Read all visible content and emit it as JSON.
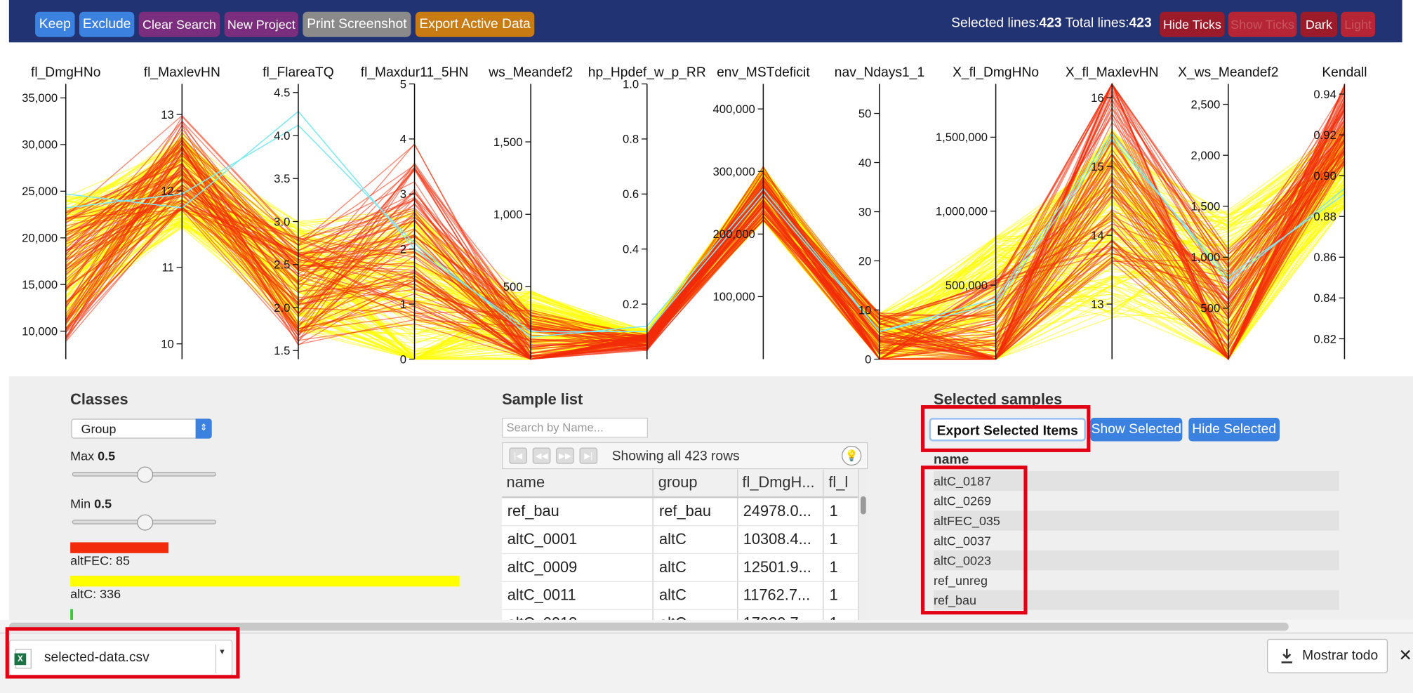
{
  "toolbar": {
    "keep": "Keep",
    "exclude": "Exclude",
    "clear_search": "Clear Search",
    "new_project": "New Project",
    "print_screenshot": "Print Screenshot",
    "export_active_data": "Export Active Data",
    "selected_lines_label": "Selected lines:",
    "selected_lines": "423",
    "total_lines_label": "Total lines:",
    "total_lines": "423",
    "hide_ticks": "Hide Ticks",
    "show_ticks": "Show Ticks",
    "dark": "Dark",
    "light": "Light",
    "colors": {
      "bar_bg": "#213372",
      "keep": "#3b82e0",
      "exclude": "#3b82e0",
      "clear": "#7b2d7e",
      "new": "#7b2d7e",
      "print": "#8a8a8a",
      "export": "#c77b12",
      "hide": "#9b1b2a",
      "disabled": "#b52535"
    }
  },
  "chart_data": {
    "type": "parallel_coordinates",
    "axes": [
      {
        "name": "fl_DmgHNo",
        "ticks": [
          "10,000",
          "15,000",
          "20,000",
          "25,000",
          "30,000",
          "35,000"
        ],
        "range": [
          7000,
          36500
        ]
      },
      {
        "name": "fl_MaxlevHN",
        "ticks": [
          "10",
          "11",
          "12",
          "13"
        ],
        "range": [
          9.8,
          13.4
        ]
      },
      {
        "name": "fl_FlareaTQ",
        "ticks": [
          "1.5",
          "2.0",
          "2.5",
          "3.0",
          "3.5",
          "4.0",
          "4.5"
        ],
        "range": [
          1.4,
          4.6
        ]
      },
      {
        "name": "fl_Maxdur11_5HN",
        "ticks": [
          "0",
          "1",
          "2",
          "3",
          "4",
          "5"
        ],
        "range": [
          0,
          5
        ]
      },
      {
        "name": "ws_Meandef2",
        "ticks": [
          "500",
          "1,000",
          "1,500"
        ],
        "range": [
          0,
          1900
        ]
      },
      {
        "name": "hp_Hpdef_w_p_RR",
        "ticks": [
          "0.2",
          "0.4",
          "0.6",
          "0.8",
          "1.0"
        ],
        "range": [
          0,
          1
        ]
      },
      {
        "name": "env_MSTdeficit",
        "ticks": [
          "100,000",
          "200,000",
          "300,000",
          "400,000"
        ],
        "range": [
          0,
          440000
        ]
      },
      {
        "name": "nav_Ndays1_1",
        "ticks": [
          "0",
          "10",
          "20",
          "30",
          "40",
          "50"
        ],
        "range": [
          0,
          56
        ]
      },
      {
        "name": "X_fl_DmgHNo",
        "ticks": [
          "500,000",
          "1,000,000",
          "1,500,000"
        ],
        "range": [
          0,
          1860000
        ]
      },
      {
        "name": "X_fl_MaxlevHN",
        "ticks": [
          "13",
          "14",
          "15",
          "16"
        ],
        "range": [
          12.2,
          16.2
        ]
      },
      {
        "name": "X_ws_Meandef2",
        "ticks": [
          "500",
          "1,000",
          "1,500",
          "2,000",
          "2,500"
        ],
        "range": [
          0,
          2700
        ]
      },
      {
        "name": "Kendall",
        "ticks": [
          "0.82",
          "0.84",
          "0.86",
          "0.88",
          "0.90",
          "0.92",
          "0.94"
        ],
        "range": [
          0.81,
          0.945
        ]
      }
    ],
    "series": [
      {
        "name": "altFEC",
        "count": 85,
        "color": "#f22b0a"
      },
      {
        "name": "altC",
        "count": 336,
        "color": "#ffff00"
      },
      {
        "name": "ref",
        "count": 2,
        "color": "#7fe8f0"
      }
    ],
    "grid": false
  },
  "classes": {
    "title": "Classes",
    "group_select": "Group",
    "max_label": "Max",
    "max_value": "0.5",
    "min_label": "Min",
    "min_value": "0.5",
    "legend": [
      {
        "label": "altFEC: 85",
        "count": 85,
        "color": "#f22b0a"
      },
      {
        "label": "altC: 336",
        "count": 336,
        "color": "#ffff00"
      },
      {
        "label": "",
        "count": 2,
        "color": "#33cc33"
      }
    ]
  },
  "sample_list": {
    "title": "Sample list",
    "search_placeholder": "Search by Name...",
    "showing": "Showing all 423 rows",
    "columns": [
      "name",
      "group",
      "fl_DmgH...",
      "fl_l"
    ],
    "rows": [
      [
        "ref_bau",
        "ref_bau",
        "24978.0...",
        "1"
      ],
      [
        "altC_0001",
        "altC",
        "10308.4...",
        "1"
      ],
      [
        "altC_0009",
        "altC",
        "12501.9...",
        "1"
      ],
      [
        "altC_0011",
        "altC",
        "11762.7...",
        "1"
      ],
      [
        "altC_0013",
        "altC",
        "17030.7...",
        "1"
      ]
    ]
  },
  "selected_samples": {
    "title": "Selected samples",
    "export_btn": "Export Selected Items",
    "show_btn": "Show Selected",
    "hide_btn": "Hide Selected",
    "column": "name",
    "items": [
      "altC_0187",
      "altC_0269",
      "altFEC_035",
      "altC_0037",
      "altC_0023",
      "ref_unreg",
      "ref_bau"
    ]
  },
  "download_bar": {
    "file_name": "selected-data.csv",
    "file_badge": "X",
    "caret": "▾",
    "show_all": "Mostrar todo",
    "close": "✕"
  }
}
